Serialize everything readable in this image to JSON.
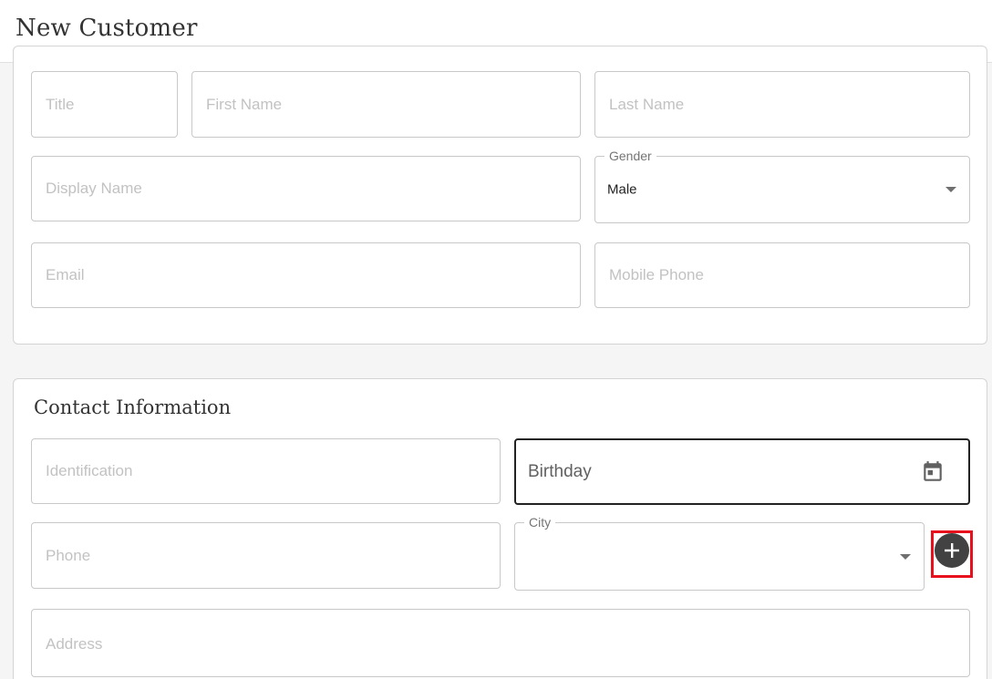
{
  "header": {
    "title": "New Customer"
  },
  "basic_info": {
    "title_placeholder": "Title",
    "first_name_placeholder": "First Name",
    "last_name_placeholder": "Last Name",
    "display_name_placeholder": "Display Name",
    "gender": {
      "label": "Gender",
      "value": "Male"
    },
    "email_placeholder": "Email",
    "mobile_phone_placeholder": "Mobile Phone"
  },
  "contact_information": {
    "section_title": "Contact Information",
    "identification_placeholder": "Identification",
    "birthday_placeholder": "Birthday",
    "birthday_icon": "calendar-icon",
    "phone_placeholder": "Phone",
    "city": {
      "label": "City",
      "value": ""
    },
    "add_city_icon": "plus-circle-icon",
    "address_placeholder": "Address"
  },
  "colors": {
    "highlight_border": "#e8101c",
    "add_button_bg": "#424242",
    "focused_border": "#222222"
  }
}
